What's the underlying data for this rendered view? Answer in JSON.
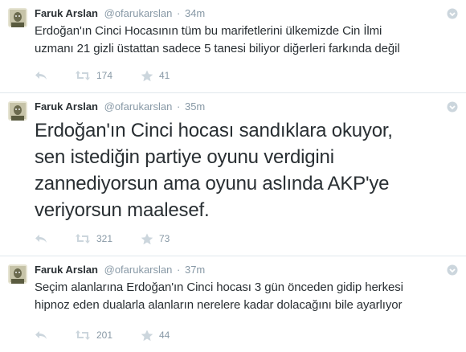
{
  "tweets": [
    {
      "fullname": "Faruk Arslan",
      "username": "@ofarukarslan",
      "dot": "·",
      "time": "34m",
      "text_lines": [
        "Erdoğan'ın Cinci Hocasının tüm bu marifetlerini ülkemizde Cin İlmi",
        "uzmanı 21 gizli üstattan sadece 5 tanesi biliyor diğerleri farkında değil"
      ],
      "retweets": "174",
      "favorites": "41"
    },
    {
      "fullname": "Faruk Arslan",
      "username": "@ofarukarslan",
      "dot": "·",
      "time": "35m",
      "text_lines": [
        "Erdoğan'ın Cinci hocası sandıklara okuyor,",
        "sen istediğin partiye oyunu verdigini",
        "zannediyorsun ama oyunu aslında AKP'ye",
        "veriyorsun maalesef."
      ],
      "retweets": "321",
      "favorites": "73"
    },
    {
      "fullname": "Faruk Arslan",
      "username": "@ofarukarslan",
      "dot": "·",
      "time": "37m",
      "text_lines": [
        "Seçim alanlarına Erdoğan'ın Cinci hocası 3 gün önceden gidip herkesi",
        "hipnoz eden dualarla alanların nerelere kadar dolacağını bile ayarlıyor"
      ],
      "retweets": "201",
      "favorites": "44"
    }
  ],
  "icons": {
    "avatar": "avatar-image",
    "caret": "chevron-down-circle-icon",
    "reply": "reply-icon",
    "retweet": "retweet-icon",
    "favorite": "star-icon"
  },
  "colors": {
    "text": "#292f33",
    "muted": "#8899a6",
    "icon": "#ccd6dd",
    "divider": "#e1e8ed"
  }
}
